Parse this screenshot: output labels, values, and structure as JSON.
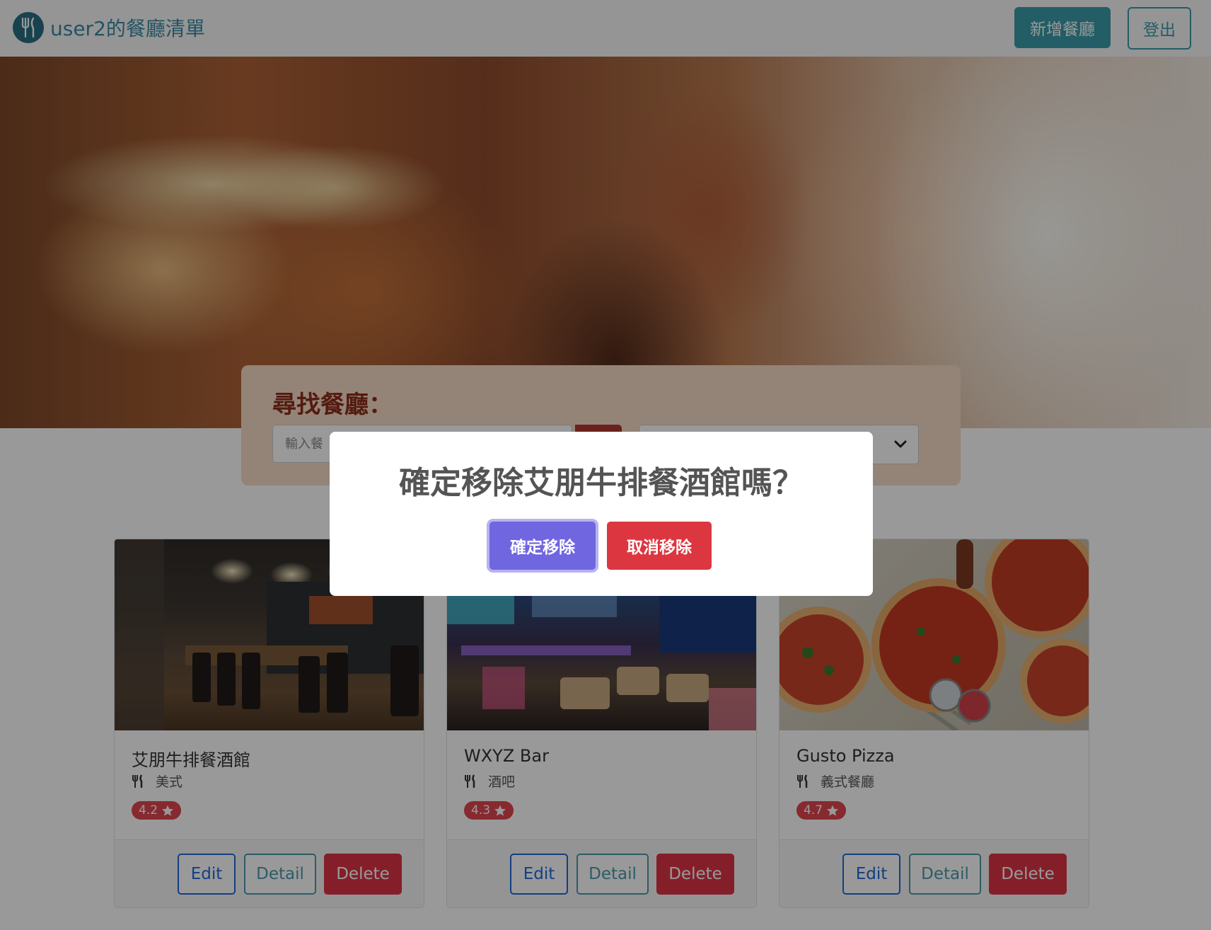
{
  "navbar": {
    "brand": "user2的餐廳清單",
    "logo_icon": "utensils-icon",
    "new_button": "新增餐廳",
    "logout_button": "登出",
    "accent_color": "#3b9cab"
  },
  "search": {
    "title": "尋找餐廳：",
    "placeholder": "輸入餐",
    "search_icon": "search-icon",
    "sort_icon": "chevron-down-icon"
  },
  "cards": [
    {
      "name": "艾朋牛排餐酒館",
      "category": "美式",
      "rating": "4.2",
      "edit": "Edit",
      "detail": "Detail",
      "delete": "Delete"
    },
    {
      "name": "WXYZ Bar",
      "category": "酒吧",
      "rating": "4.3",
      "edit": "Edit",
      "detail": "Detail",
      "delete": "Delete"
    },
    {
      "name": "Gusto Pizza",
      "category": "義式餐廳",
      "rating": "4.7",
      "edit": "Edit",
      "detail": "Detail",
      "delete": "Delete"
    }
  ],
  "modal": {
    "title": "確定移除艾朋牛排餐酒館嗎？",
    "confirm": "確定移除",
    "cancel": "取消移除",
    "confirm_color": "#7066e0",
    "cancel_color": "#dc3741"
  }
}
